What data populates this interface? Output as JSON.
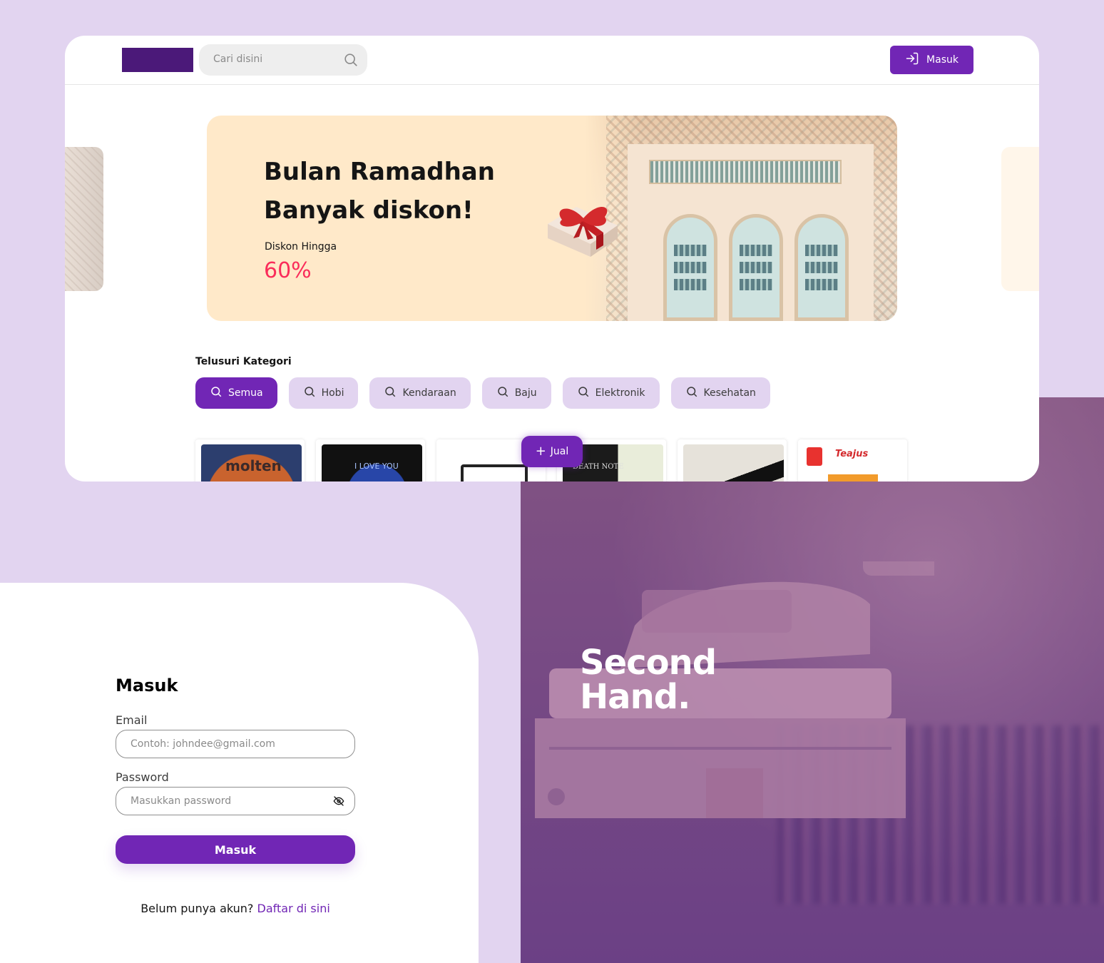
{
  "navbar": {
    "search_placeholder": "Cari disini",
    "login_label": "Masuk"
  },
  "banner": {
    "title": "Bulan Ramadhan Banyak diskon!",
    "subtitle": "Diskon Hingga",
    "discount": "60%"
  },
  "categories": {
    "title": "Telusuri Kategori",
    "items": [
      {
        "label": "Semua",
        "active": true
      },
      {
        "label": "Hobi"
      },
      {
        "label": "Kendaraan"
      },
      {
        "label": "Baju"
      },
      {
        "label": "Elektronik"
      },
      {
        "label": "Kesehatan"
      }
    ]
  },
  "sell_button": "Jual",
  "products": [
    {
      "image_text": "molten"
    },
    {
      "image_text": "I LOVE YOU"
    },
    {
      "image_text": ""
    },
    {
      "image_text": "DEATH NOTE"
    },
    {
      "image_text": ""
    },
    {
      "image_text": "Teajus"
    }
  ],
  "login": {
    "title": "Masuk",
    "email_label": "Email",
    "email_placeholder": "Contoh: johndee@gmail.com",
    "password_label": "Password",
    "password_placeholder": "Masukkan password",
    "submit_label": "Masuk",
    "register_prompt": "Belum punya akun?",
    "register_link": "Daftar di sini"
  },
  "hero": {
    "brand_line1": "Second",
    "brand_line2": "Hand."
  },
  "colors": {
    "primary": "#7126b5",
    "primary_light": "#e2d4f0",
    "discount": "#fa2c5a",
    "banner_bg": "#ffe9c9"
  }
}
